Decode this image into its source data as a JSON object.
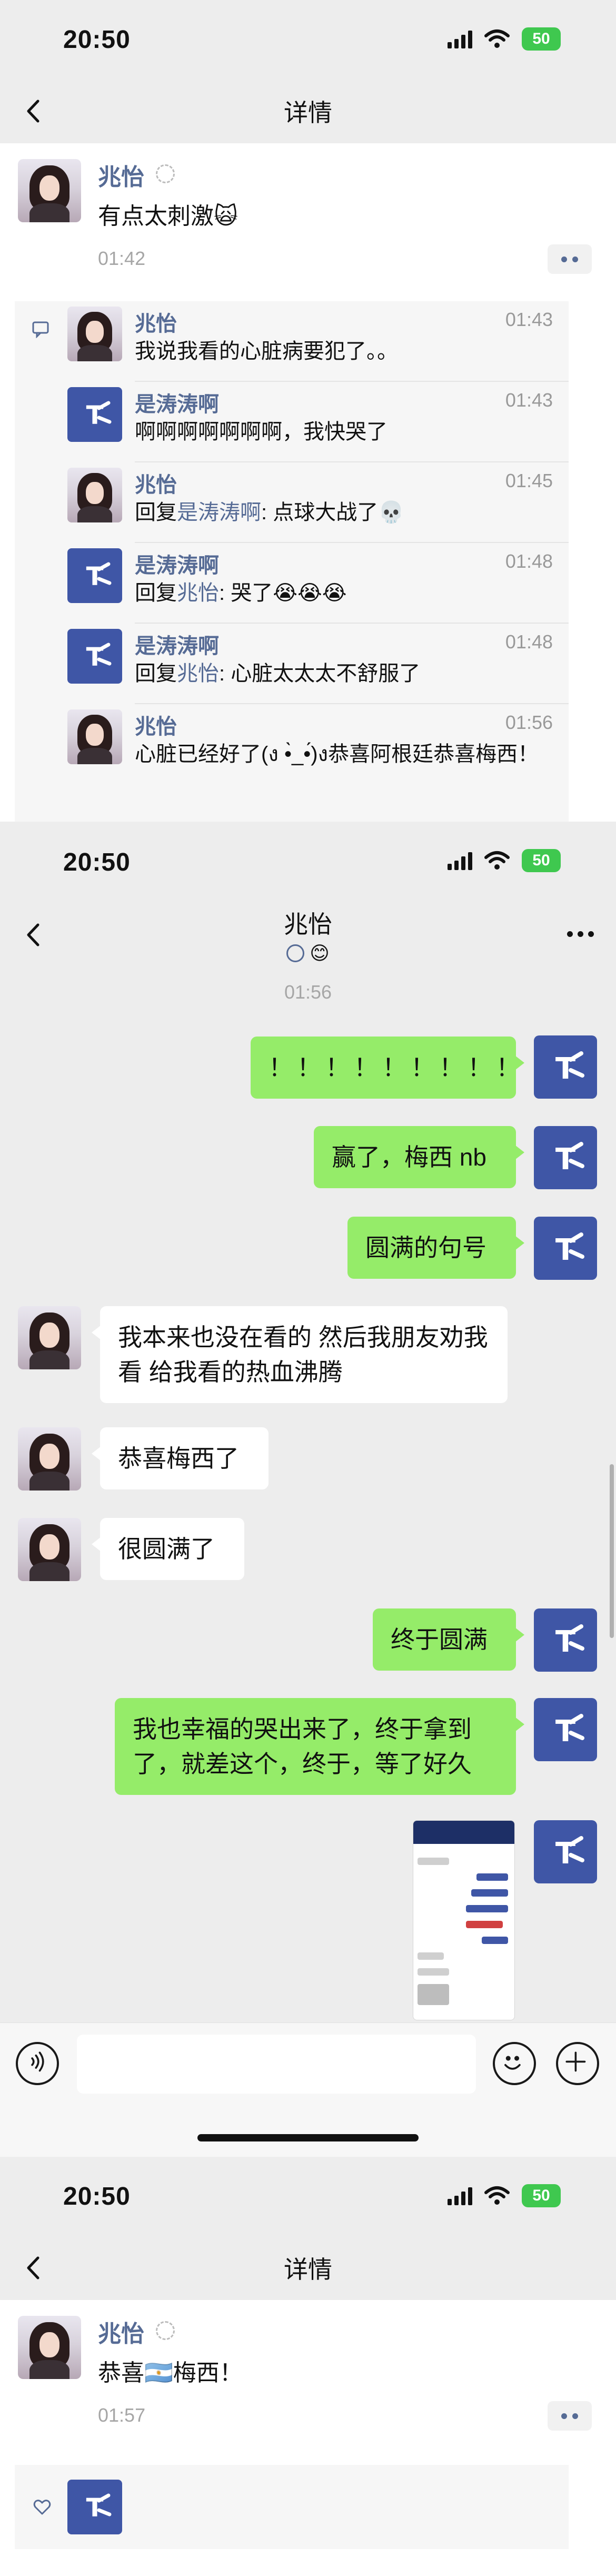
{
  "status_bar": {
    "time": "20:50",
    "battery": "50"
  },
  "detail_page": {
    "title": "详情",
    "post": {
      "author": "兆怡",
      "text": "有点太刺激🙀",
      "time": "01:42",
      "comments": [
        {
          "author": "兆怡",
          "time": "01:43",
          "text": "我说我看的心脏病要犯了。。",
          "avatar": "girl"
        },
        {
          "author": "是涛涛啊",
          "time": "01:43",
          "text": "啊啊啊啊啊啊啊，我快哭了",
          "avatar": "tao"
        },
        {
          "author": "兆怡",
          "time": "01:45",
          "reply_prefix": "回复",
          "reply_to": "是涛涛啊",
          "text": ": 点球大战了💀",
          "avatar": "girl"
        },
        {
          "author": "是涛涛啊",
          "time": "01:48",
          "reply_prefix": "回复",
          "reply_to": "兆怡",
          "text": ": 哭了😭😭😭",
          "avatar": "tao"
        },
        {
          "author": "是涛涛啊",
          "time": "01:48",
          "reply_prefix": "回复",
          "reply_to": "兆怡",
          "text": ": 心脏太太太不舒服了",
          "avatar": "tao"
        },
        {
          "author": "兆怡",
          "time": "01:56",
          "text": "心脏已经好了(ง •̀_•́)ง恭喜阿根廷恭喜梅西！",
          "avatar": "girl"
        }
      ]
    }
  },
  "chat_page": {
    "title": "兆怡",
    "status_emoji": "😊",
    "timestamp": "01:56",
    "messages": [
      {
        "side": "me",
        "text": "！！！！！！！！！"
      },
      {
        "side": "me",
        "text": "赢了，梅西 nb"
      },
      {
        "side": "me",
        "text": "圆满的句号"
      },
      {
        "side": "them",
        "text": "我本来也没在看的 然后我朋友劝我看 给我看的热血沸腾"
      },
      {
        "side": "them",
        "text": "恭喜梅西了"
      },
      {
        "side": "them",
        "text": "很圆满了"
      },
      {
        "side": "me",
        "text": "终于圆满"
      },
      {
        "side": "me",
        "text": "我也幸福的哭出来了，终于拿到了，就差这个，终于，等了好久"
      },
      {
        "side": "me",
        "type": "image",
        "text": ""
      }
    ]
  },
  "detail_page_2": {
    "title": "详情",
    "post": {
      "author": "兆怡",
      "text": "恭喜🇦🇷梅西！",
      "time": "01:57"
    }
  },
  "colors": {
    "link": "#566b95",
    "my_bubble": "#95ec69",
    "their_bubble": "#ffffff",
    "chat_bg": "#ededed",
    "tao_avatar": "#3f56a6"
  },
  "icons": [
    "back-icon",
    "more-icon",
    "signal-icon",
    "wifi-icon",
    "battery-icon",
    "comment-icon",
    "like-icon",
    "voice-icon",
    "emoji-icon",
    "plus-icon"
  ]
}
